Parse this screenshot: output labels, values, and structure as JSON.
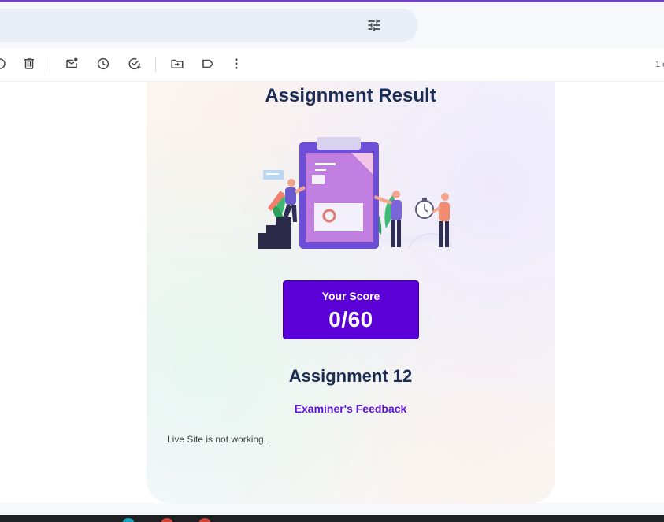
{
  "app": {
    "accent": "#6f42c1"
  },
  "search": {
    "options_icon": "tune-icon"
  },
  "toolbar": {
    "icons": [
      "report-spam-icon",
      "delete-icon",
      "mark-unread-icon",
      "snooze-icon",
      "add-to-tasks-icon",
      "move-to-icon",
      "label-icon",
      "more-options-icon"
    ],
    "page_count": "1 c"
  },
  "email": {
    "title": "Assignment Result",
    "illustration": "assignment-clipboard-illustration",
    "score": {
      "label": "Your Score",
      "value": "0/60",
      "color": "#5b00d6"
    },
    "assignment_name": "Assignment 12",
    "feedback_title": "Examiner's Feedback",
    "feedback_text": "Live Site is not working."
  }
}
